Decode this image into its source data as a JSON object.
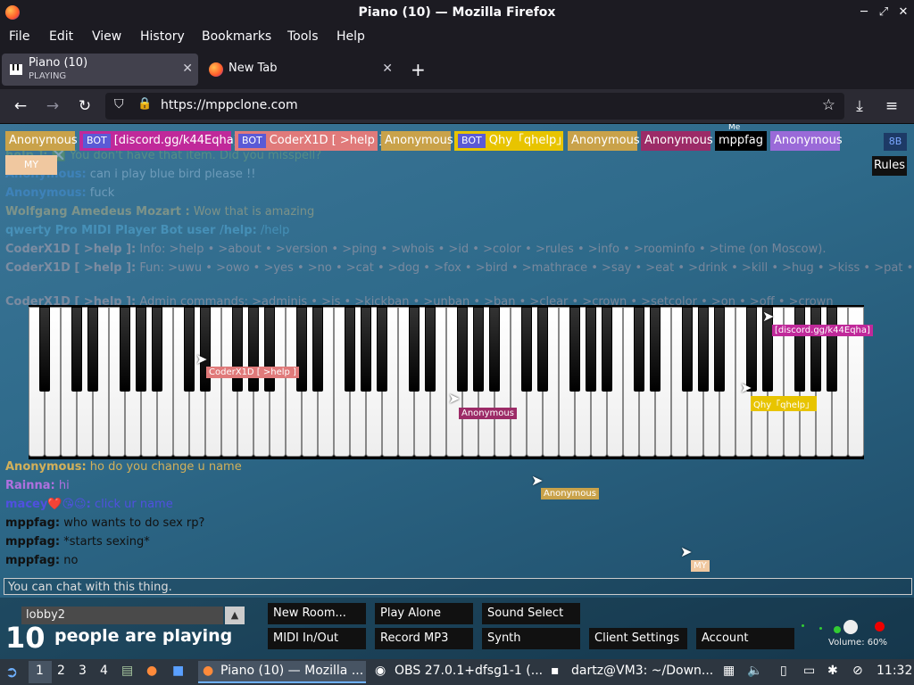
{
  "window": {
    "title": "Piano (10) — Mozilla Firefox"
  },
  "menu": [
    "File",
    "Edit",
    "View",
    "History",
    "Bookmarks",
    "Tools",
    "Help"
  ],
  "tabs": [
    {
      "title": "Piano (10)",
      "subtitle": "PLAYING"
    },
    {
      "title": "New Tab"
    }
  ],
  "address": {
    "url": "https://mppclone.com"
  },
  "users": [
    {
      "name": "Anonymous",
      "color": "#c9a24a"
    },
    {
      "name": "[discord.gg/k44Eqha]",
      "color": "#c0299a",
      "bot": "BOT"
    },
    {
      "name": "CoderX1D [ >help ]",
      "color": "#e07a7a",
      "bot": "BOT"
    },
    {
      "name": "Anonymous",
      "color": "#c9a24a"
    },
    {
      "name": "Qhy「qhelp」",
      "color": "#e8c400",
      "bot": "BOT"
    },
    {
      "name": "Anonymous",
      "color": "#c9a24a"
    },
    {
      "name": "Anonymous",
      "color": "#9c2b67"
    },
    {
      "name": "mppfag",
      "color": "#000000",
      "tag": "Me"
    },
    {
      "name": "Anonymous",
      "color": "#9a6ad8"
    }
  ],
  "my_chip": "MY",
  "rules": "Rules",
  "chat": [
    {
      "name": "help ]:",
      "text": "❎ You don't have that item. Did you misspell?",
      "faded": true
    },
    {
      "name": "Anonymous:",
      "text": "can i play blue bird  please !!",
      "faded": true
    },
    {
      "name": "Anonymous:",
      "text": "fuck",
      "faded": true
    },
    {
      "name": "Wolfgang Amedeus Mozart :",
      "text": "Wow that is amazing",
      "faded": true
    },
    {
      "name": "qwerty Pro MIDI Player Bot user /help:",
      "text": "/help",
      "faded": true
    },
    {
      "name": "CoderX1D [ >help ]:",
      "text": "Info: >help • >about • >version • >ping • >whois • >id • >color • >rules • >info • >roominfo • >time (on Moscow).",
      "faded": true
    },
    {
      "name": "CoderX1D [ >help ]:",
      "text": "Fun: >uwu • >owo • >yes • >no • >cat • >dog • >fox • >bird • >mathrace • >say • >eat • >drink • >kill • >hug • >kiss • >pat • >me.",
      "faded": true
    },
    {
      "name": "CoderX1D [ >help ]:",
      "text": "Admin commands: >adminjs • >js • >kickban • >unban • >ban • >clear • >crown • >setcolor • >on • >off • >crown",
      "faded": true
    },
    {
      "name": "Anonymous:",
      "text": "ho do you change u name",
      "faded": false
    },
    {
      "name": "Rainna:",
      "text": "hi",
      "faded": false
    },
    {
      "name": "macey❤️😘😉:",
      "text": "click ur name",
      "faded": false
    },
    {
      "name": "mppfag:",
      "text": "who wants to do sex rp?",
      "faded": false
    },
    {
      "name": "mppfag:",
      "text": "*starts sexing*",
      "faded": false
    },
    {
      "name": "mppfag:",
      "text": "no",
      "faded": false
    }
  ],
  "cursors": [
    {
      "name": "[discord.gg/k44Eqha]",
      "color": "#c0299a"
    },
    {
      "name": "CoderX1D [ >help ]",
      "color": "#e07a7a"
    },
    {
      "name": "Anonymous",
      "color": "#9c2b67"
    },
    {
      "name": "Qhy「qhelp」",
      "color": "#e8c400"
    },
    {
      "name": "Anonymous",
      "color": "#c9a24a"
    },
    {
      "name": "MY",
      "color": "#f0c8a0"
    }
  ],
  "chat_input": {
    "placeholder": "You can chat with this thing."
  },
  "room": {
    "name": "lobby2"
  },
  "people": {
    "count": "10",
    "label": "people are playing"
  },
  "buttons": {
    "new_room": "New Room...",
    "play_alone": "Play Alone",
    "sound_select": "Sound Select",
    "midi": "MIDI In/Out",
    "record": "Record MP3",
    "synth": "Synth",
    "client_settings": "Client Settings",
    "account": "Account"
  },
  "volume": "Volume: 60%",
  "taskbar": {
    "workspaces": [
      "1",
      "2",
      "3",
      "4"
    ],
    "apps": [
      "Piano (10) — Mozilla ...",
      "OBS 27.0.1+dfsg1-1 (...",
      "dartz@VM3: ~/Down..."
    ],
    "clock": "11:32"
  }
}
